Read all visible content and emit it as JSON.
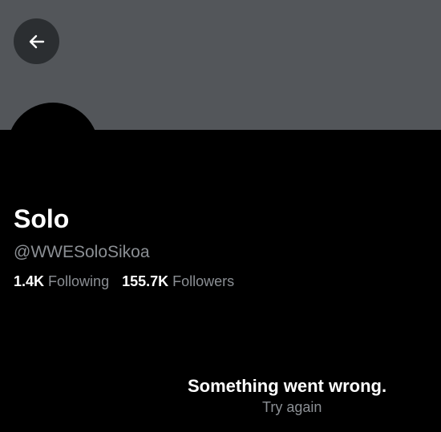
{
  "profile": {
    "display_name": "Solo",
    "handle": "@WWESoloSikoa",
    "following_count": "1.4K",
    "following_label": "Following",
    "followers_count": "155.7K",
    "followers_label": "Followers"
  },
  "icons": {
    "back": "arrow-left-icon"
  },
  "error": {
    "title": "Something went wrong.",
    "retry_label": "Try again"
  },
  "colors": {
    "background": "#000000",
    "banner": "#53565a",
    "back_button": "#2b2e31",
    "text_primary": "#ffffff",
    "text_secondary": "#8b8f94"
  }
}
